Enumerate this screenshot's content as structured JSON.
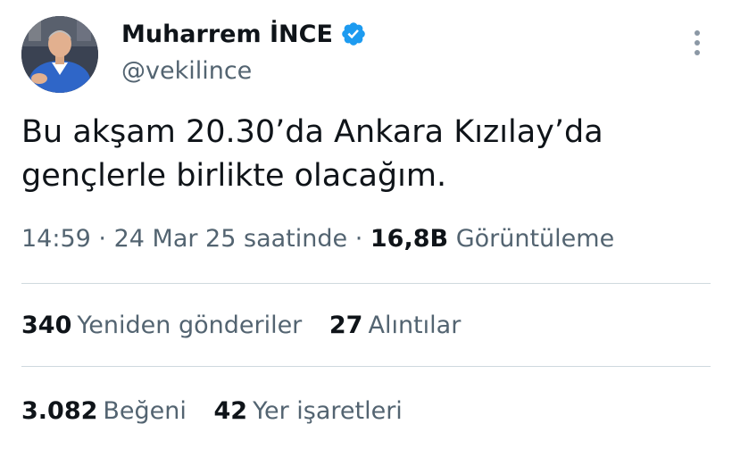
{
  "author": {
    "display_name": "Muharrem İNCE",
    "handle": "@vekilince",
    "verified_icon": "verified-badge-icon",
    "verified_color": "#1d9bf0"
  },
  "tweet": {
    "text_line1": "Bu akşam 20.30’da Ankara Kızılay’da",
    "text_line2": "gençlerle birlikte olacağım."
  },
  "meta": {
    "time": "14:59",
    "separator1": "·",
    "date": "24 Mar 25 saatinde",
    "separator2": "·",
    "views_count": "16,8B",
    "views_label": "Görüntüleme"
  },
  "stats": {
    "retweets_count": "340",
    "retweets_label": "Yeniden gönderiler",
    "quotes_count": "27",
    "quotes_label": "Alıntılar",
    "likes_count": "3.082",
    "likes_label": "Beğeni",
    "bookmarks_count": "42",
    "bookmarks_label": "Yer işaretleri"
  },
  "colors": {
    "text_primary": "#0f1419",
    "text_secondary": "#536471",
    "divider": "#cfd9de"
  },
  "icons": {
    "more": "more-options-icon"
  }
}
